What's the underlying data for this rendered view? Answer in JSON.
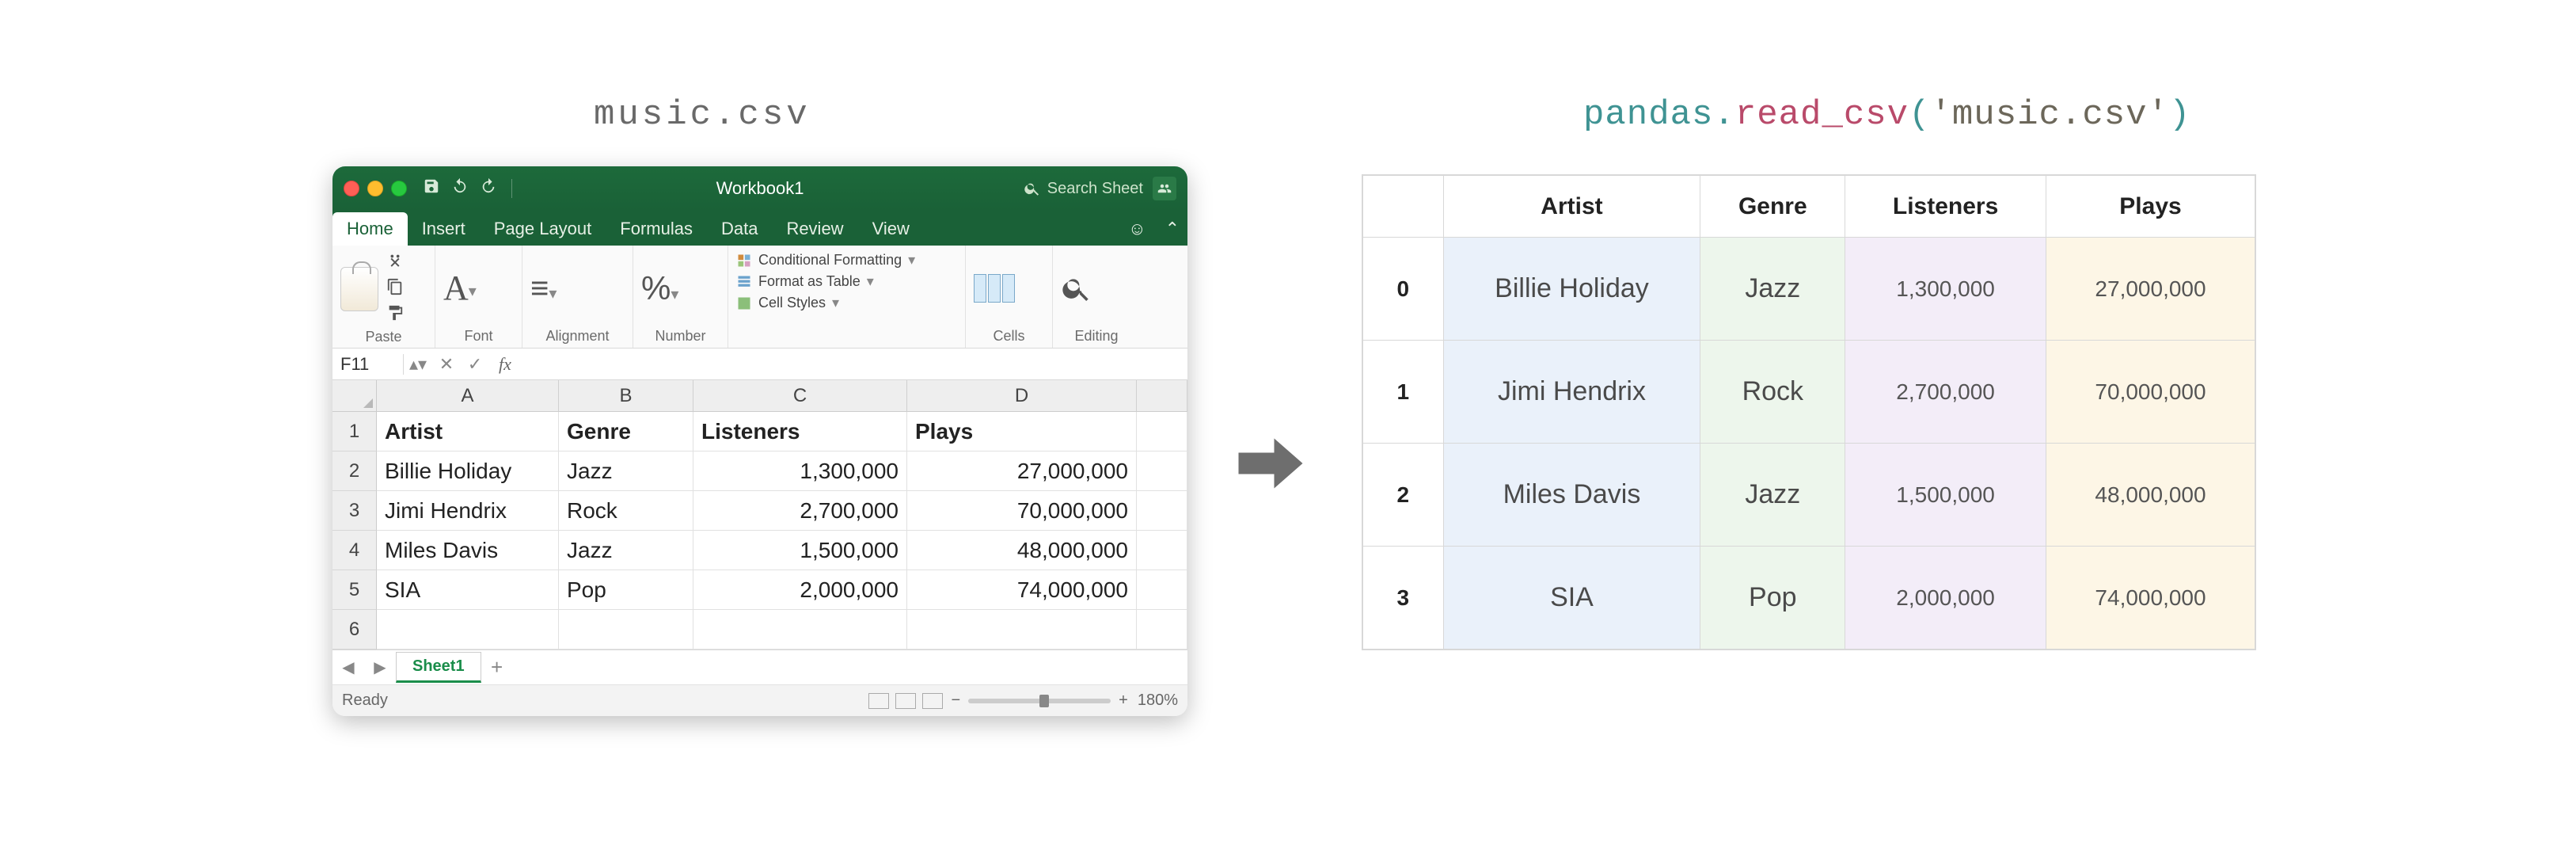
{
  "labels": {
    "left": "music.csv",
    "right_module": "pandas",
    "right_func": "read_csv",
    "right_arg": "'music.csv'"
  },
  "excel": {
    "workbook_title": "Workbook1",
    "search_placeholder": "Search Sheet",
    "tabs": [
      "Home",
      "Insert",
      "Page Layout",
      "Formulas",
      "Data",
      "Review",
      "View"
    ],
    "active_tab": "Home",
    "ribbon_groups": {
      "paste": "Paste",
      "font": "Font",
      "alignment": "Alignment",
      "number": "Number",
      "cf": "Conditional Formatting",
      "fat": "Format as Table",
      "cs": "Cell Styles",
      "cells": "Cells",
      "editing": "Editing"
    },
    "namebox": "F11",
    "col_headers": [
      "A",
      "B",
      "C",
      "D"
    ],
    "row_headers": [
      "1",
      "2",
      "3",
      "4",
      "5",
      "6"
    ],
    "header_row": [
      "Artist",
      "Genre",
      "Listeners",
      "Plays"
    ],
    "data": [
      [
        "Billie Holiday",
        "Jazz",
        "1,300,000",
        "27,000,000"
      ],
      [
        "Jimi Hendrix",
        "Rock",
        "2,700,000",
        "70,000,000"
      ],
      [
        "Miles Davis",
        "Jazz",
        "1,500,000",
        "48,000,000"
      ],
      [
        "SIA",
        "Pop",
        "2,000,000",
        "74,000,000"
      ]
    ],
    "sheet_name": "Sheet1",
    "status": "Ready",
    "zoom": "180%"
  },
  "pandas": {
    "columns": [
      "Artist",
      "Genre",
      "Listeners",
      "Plays"
    ],
    "index": [
      "0",
      "1",
      "2",
      "3"
    ],
    "rows": [
      [
        "Billie Holiday",
        "Jazz",
        "1,300,000",
        "27,000,000"
      ],
      [
        "Jimi Hendrix",
        "Rock",
        "2,700,000",
        "70,000,000"
      ],
      [
        "Miles Davis",
        "Jazz",
        "1,500,000",
        "48,000,000"
      ],
      [
        "SIA",
        "Pop",
        "2,000,000",
        "74,000,000"
      ]
    ]
  },
  "chart_data": {
    "type": "table",
    "title": "music.csv",
    "columns": [
      "Artist",
      "Genre",
      "Listeners",
      "Plays"
    ],
    "rows": [
      {
        "Artist": "Billie Holiday",
        "Genre": "Jazz",
        "Listeners": 1300000,
        "Plays": 27000000
      },
      {
        "Artist": "Jimi Hendrix",
        "Genre": "Rock",
        "Listeners": 2700000,
        "Plays": 70000000
      },
      {
        "Artist": "Miles Davis",
        "Genre": "Jazz",
        "Listeners": 1500000,
        "Plays": 48000000
      },
      {
        "Artist": "SIA",
        "Genre": "Pop",
        "Listeners": 2000000,
        "Plays": 74000000
      }
    ]
  }
}
